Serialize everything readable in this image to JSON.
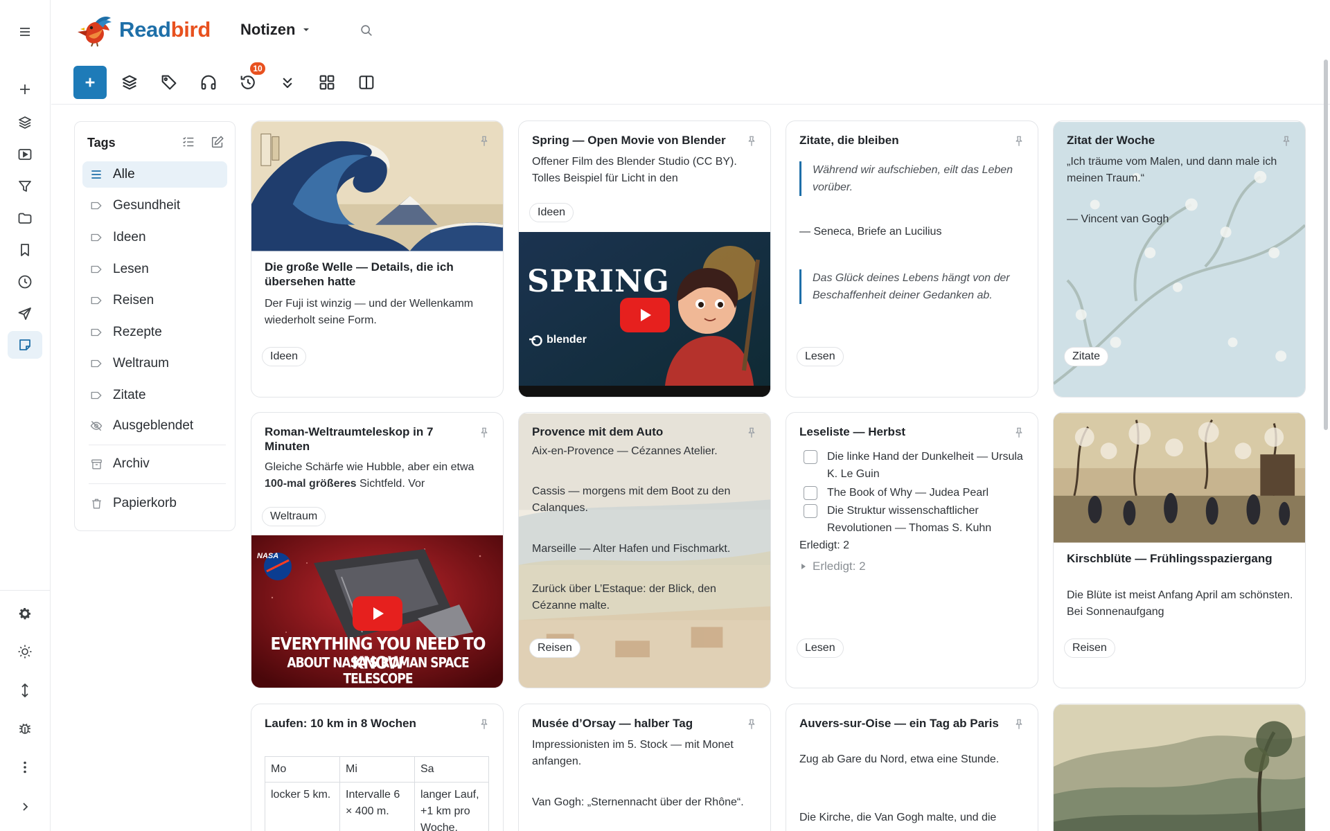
{
  "app": {
    "name": "Readbird",
    "view": "Notizen"
  },
  "toolbar": {
    "history_badge": "10"
  },
  "tags_panel": {
    "title": "Tags",
    "items": [
      "Alle",
      "Gesundheit",
      "Ideen",
      "Lesen",
      "Reisen",
      "Rezepte",
      "Weltraum",
      "Zitate",
      "Ausgeblendet"
    ],
    "archive": "Archiv",
    "trash": "Papierkorb"
  },
  "cards": {
    "welle": {
      "title": "Die große Welle — Details, die ich übersehen hatte",
      "text": "Der Fuji ist winzig — und der Wellenkamm wiederholt seine Form.",
      "tag": "Ideen"
    },
    "spring": {
      "title": "Spring — Open Movie von Blender",
      "text": "Offener Film des Blender Studio (CC BY). Tolles Beispiel für Licht in den",
      "tag": "Ideen",
      "video_title": "SPRING",
      "video_brand": "blender"
    },
    "zitate": {
      "title": "Zitate, die bleiben",
      "quote1": "Während wir aufschieben, eilt das Leben vorüber.",
      "attribution": "— Seneca, Briefe an Lucilius",
      "quote2": "Das Glück deines Lebens hängt von der Beschaffenheit deiner Gedanken ab.",
      "tag": "Lesen"
    },
    "woche": {
      "title": "Zitat der Woche",
      "text": "„Ich träume vom Malen, und dann male ich meinen Traum.“",
      "author": "— Vincent van Gogh",
      "tag": "Zitate"
    },
    "roman": {
      "title": "Roman-Weltraumteleskop in 7 Minuten",
      "text_before": "Gleiche Schärfe wie Hubble, aber ein etwa ",
      "text_bold": "100-mal größeres",
      "text_after": " Sichtfeld. Vor",
      "tag": "Weltraum",
      "video_line1": "EVERYTHING YOU NEED TO KNOW",
      "video_line2": "ABOUT NASA'S ROMAN SPACE TELESCOPE",
      "video_brand": "NASA"
    },
    "provence": {
      "title": "Provence mit dem Auto",
      "lines": [
        "Aix-en-Provence — Cézannes Atelier.",
        "Cassis — morgens mit dem Boot zu den Calanques.",
        "Marseille — Alter Hafen und Fischmarkt.",
        "Zurück über L’Estaque: der Blick, den Cézanne malte."
      ],
      "tag": "Reisen"
    },
    "leseliste": {
      "title": "Leseliste — Herbst",
      "items": [
        "Die linke Hand der Dunkelheit — Ursula K. Le Guin",
        "The Book of Why — Judea Pearl",
        "Die Struktur wissenschaftlicher Revolutionen — Thomas S. Kuhn"
      ],
      "done_count": "Erledigt: 2",
      "done_toggle": "Erledigt: 2",
      "tag": "Lesen"
    },
    "kirsch": {
      "title": "Kirschblüte — Frühlingsspaziergang",
      "text": "Die Blüte ist meist Anfang April am schönsten. Bei Sonnenaufgang",
      "tag": "Reisen"
    },
    "laufen": {
      "title": "Laufen: 10 km in 8 Wochen",
      "table": {
        "head": [
          "Mo",
          "Mi",
          "Sa"
        ],
        "row": [
          "locker 5 km.",
          "Intervalle 6 × 400 m.",
          "langer Lauf, +1 km pro Woche."
        ]
      }
    },
    "orsay": {
      "title": "Musée d’Orsay — halber Tag",
      "line1": "Impressionisten im 5. Stock — mit Monet anfangen.",
      "line2": "Van Gogh: „Sternennacht über der Rhône“."
    },
    "auvers": {
      "title": "Auvers-sur-Oise — ein Tag ab Paris",
      "line1": "Zug ab Gare du Nord, etwa eine Stunde.",
      "line2": "Die Kirche, die Van Gogh malte, und die"
    }
  },
  "colors": {
    "accent": "#1e6fa8",
    "logo_orange": "#e8511f",
    "badge": "#e8511f",
    "play": "#e6201e"
  }
}
